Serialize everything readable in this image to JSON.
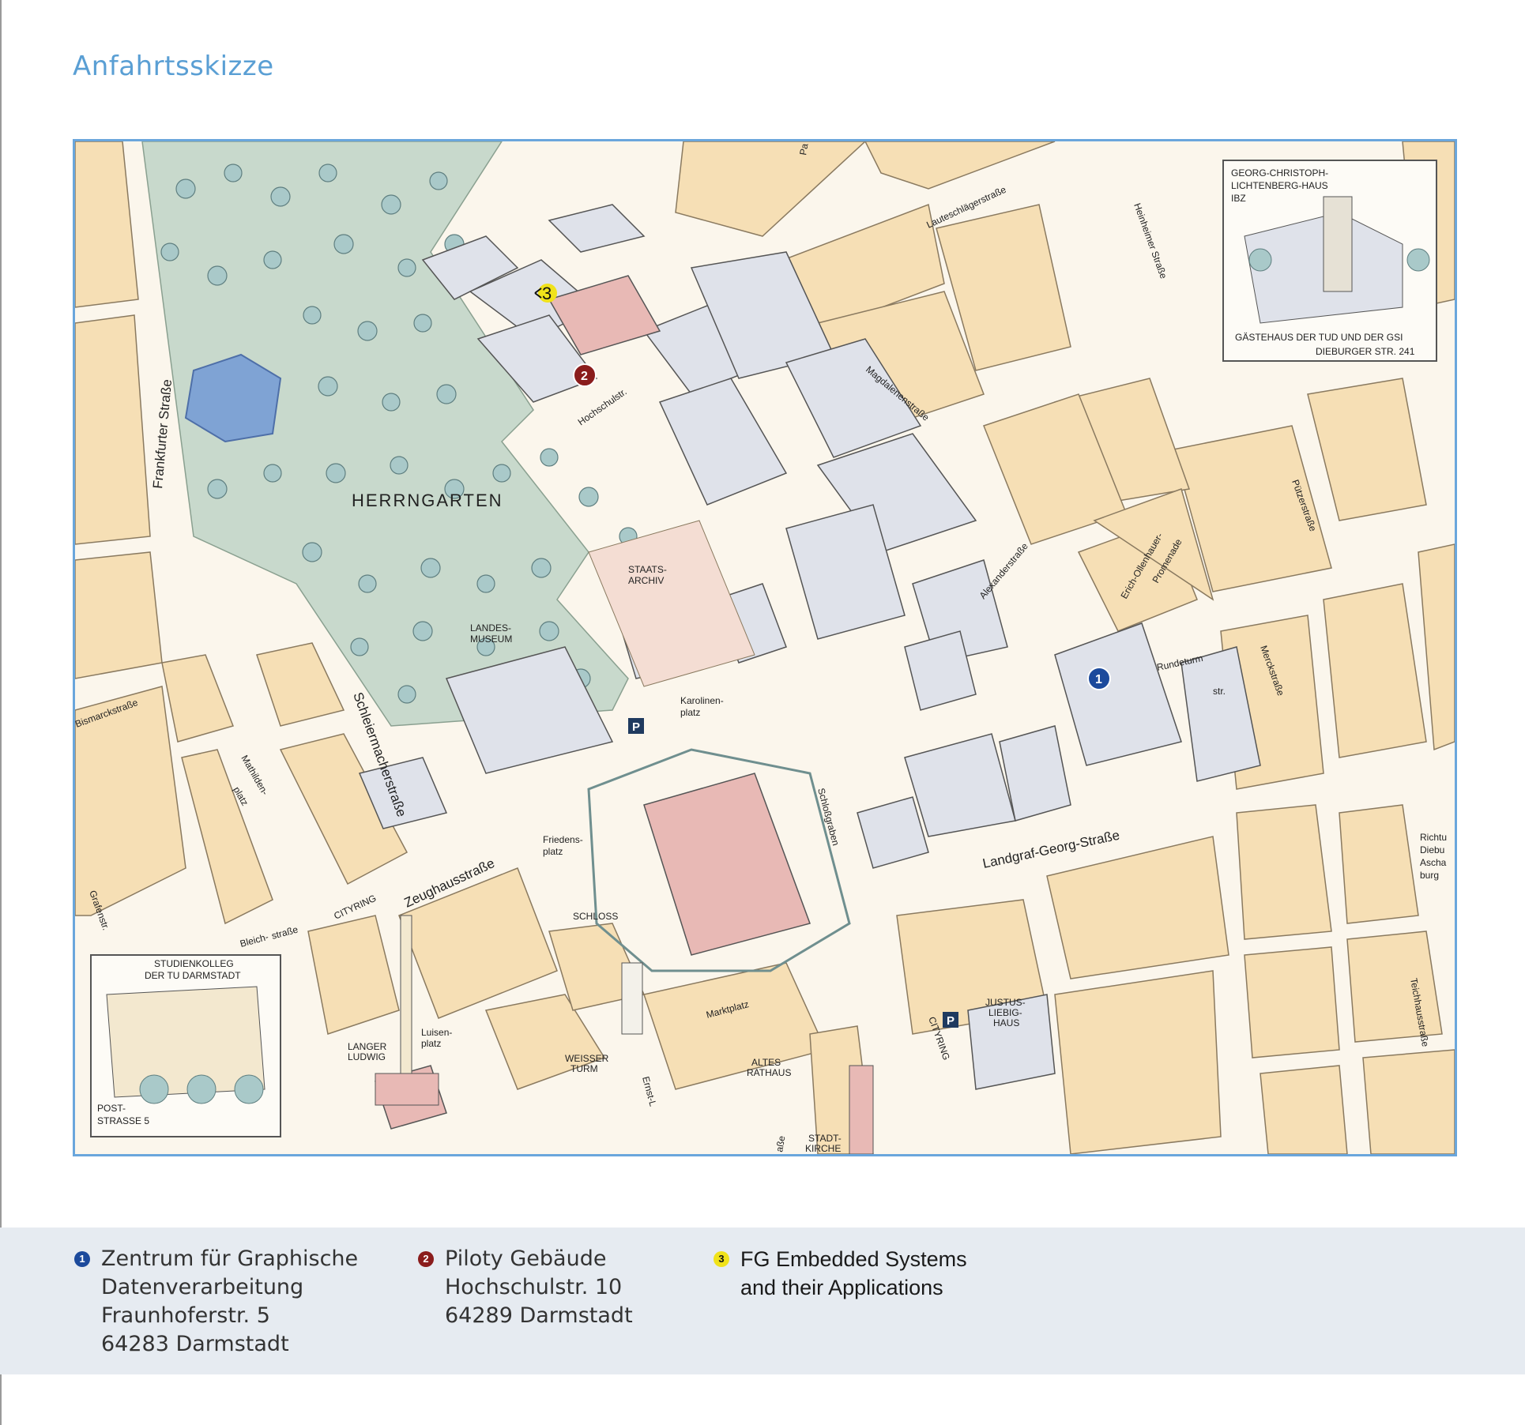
{
  "page": {
    "title": "Anfahrtsskizze"
  },
  "map": {
    "labels": {
      "herrngarten": "HERRNGARTEN",
      "frankfurter": "Frankfurter Straße",
      "bismarck": "Bismarckstraße",
      "schleiermacher": "Schleiermacherstraße",
      "mathildenplatz_1": "Mathilden-",
      "mathildenplatz_2": "platz",
      "hochschulstr": "Hochschulstr.",
      "lauteschlaeger": "Lauteschlägerstraße",
      "heinheimer": "Heinheimer Straße",
      "magdalenen": "Magdalenenstraße",
      "alexander": "Alexanderstraße",
      "ollenhauer_1": "Erich-Ollenhauer-",
      "ollenhauer_2": "Promenade",
      "puetzer": "Pützerstraße",
      "rundeturm_1": "Rundeturm",
      "rundeturm_2": "str.",
      "merck": "Merckstraße",
      "landgraf": "Landgraf-Georg-Straße",
      "schlossgraben": "Schloßgraben",
      "zeughaus": "Zeughausstraße",
      "cityring_a": "CITYRING",
      "cityring_b": "CITYRING",
      "bleich_1": "Bleich-",
      "bleich_2": "straße",
      "grafen": "Grafenstr.",
      "staatsarchiv_1": "STAATS-",
      "staatsarchiv_2": "ARCHIV",
      "landesmuseum_1": "LANDES-",
      "landesmuseum_2": "MUSEUM",
      "karolinenplatz_1": "Karolinen-",
      "karolinenplatz_2": "platz",
      "friedensplatz_1": "Friedens-",
      "friedensplatz_2": "platz",
      "schloss": "SCHLOSS",
      "marktplatz": "Marktplatz",
      "langer_ludwig_1": "LANGER",
      "langer_ludwig_2": "LUDWIG",
      "luisenplatz_1": "Luisen-",
      "luisenplatz_2": "platz",
      "weisser_turm_1": "WEISSER",
      "weisser_turm_2": "TURM",
      "altes_rathaus_1": "ALTES",
      "altes_rathaus_2": "RATHAUS",
      "stadtkirche_1": "STADT-",
      "stadtkirche_2": "KIRCHE",
      "justus_1": "JUSTUS-",
      "justus_2": "LIEBIG-",
      "justus_3": "HAUS",
      "teichhaus": "Teichhausstraße",
      "ernst": "Ernst-L",
      "richtung_1": "Richtu",
      "richtung_2": "Diebu",
      "richtung_3": "Ascha",
      "richtung_4": "burg",
      "parking": "P",
      "strasse_fragment": "aße",
      "pa_fragment": "Pa"
    },
    "inset_guesthouse": {
      "line1": "GEORG-CHRISTOPH-",
      "line2": "LICHTENBERG-HAUS",
      "line3": "IBZ",
      "caption1": "GÄSTEHAUS DER TUD UND DER GSI",
      "caption2": "DIEBURGER STR. 241"
    },
    "inset_studienkolleg": {
      "line1": "STUDIENKOLLEG",
      "line2": "DER TU DARMSTADT",
      "caption1": "POST-",
      "caption2": "STRASSE 5"
    },
    "markers": [
      {
        "number": "1",
        "color": "#1c4a9c"
      },
      {
        "number": "2",
        "color": "#8a1c1c"
      },
      {
        "number": "3",
        "color": "#f0e21a"
      }
    ],
    "colors": {
      "block": "#f6dfb5",
      "street": "#fbf6ec",
      "park": "#c8d9cc",
      "tree": "#a9c9c9",
      "pond": "#7fa3d4",
      "building": "#dfe2ea",
      "building_red": "#e8b9b5"
    }
  },
  "legend": [
    {
      "marker": "1",
      "lines": [
        "Zentrum für Graphische",
        "Datenverarbeitung",
        "Fraunhoferstr. 5",
        "64283 Darmstadt"
      ]
    },
    {
      "marker": "2",
      "lines": [
        "Piloty Gebäude",
        "Hochschulstr. 10",
        "64289 Darmstadt"
      ]
    },
    {
      "marker": "3",
      "lines": [
        "FG Embedded Systems",
        "and their Applications"
      ]
    }
  ]
}
